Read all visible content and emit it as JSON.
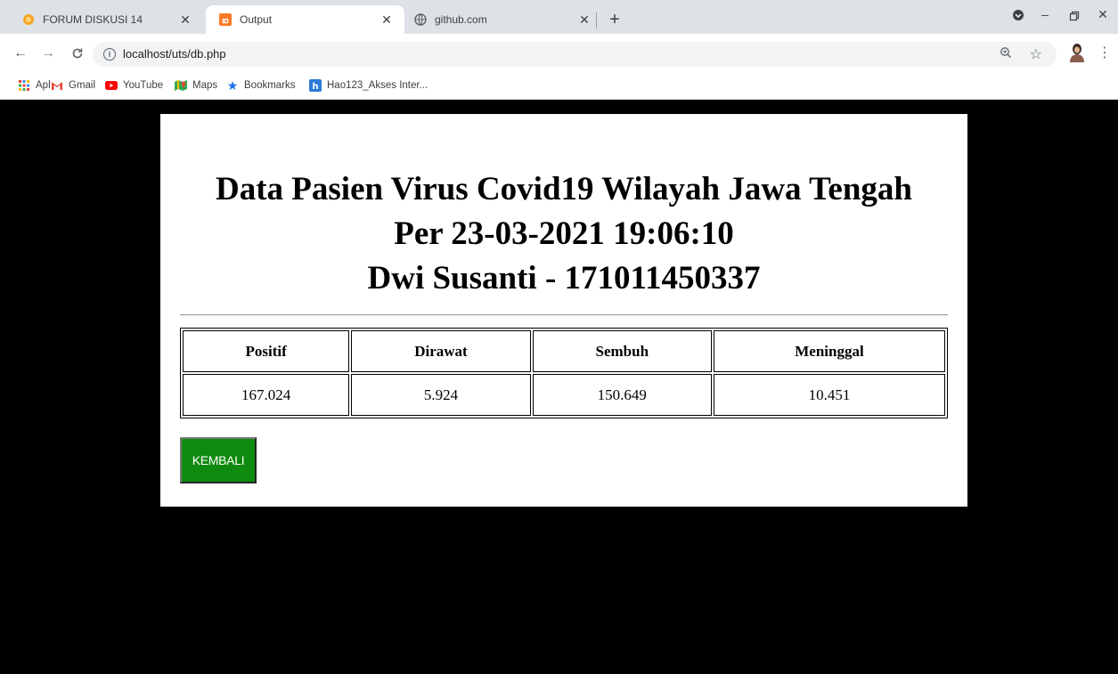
{
  "browser": {
    "tabs": [
      {
        "title": "FORUM DISKUSI 14",
        "icon": "moodle-icon",
        "active": false
      },
      {
        "title": "Output",
        "icon": "xampp-icon",
        "active": true
      },
      {
        "title": "github.com",
        "icon": "globe-icon",
        "active": false
      }
    ],
    "new_tab_glyph": "+",
    "address": {
      "url": "localhost/uts/db.php"
    },
    "bookmarks": [
      {
        "label": "Apl",
        "icon": "apps-grid-icon"
      },
      {
        "label": "Gmail",
        "icon": "gmail-icon"
      },
      {
        "label": "YouTube",
        "icon": "youtube-icon"
      },
      {
        "label": "Maps",
        "icon": "maps-icon"
      },
      {
        "label": "Bookmarks",
        "icon": "star-icon"
      },
      {
        "label": "Hao123_Akses Inter...",
        "icon": "hao123-icon"
      }
    ]
  },
  "page": {
    "heading_line1": "Data Pasien Virus Covid19 Wilayah Jawa Tengah",
    "heading_line2": "Per 23-03-2021 19:06:10",
    "heading_line3": "Dwi Susanti - 171011450337",
    "table": {
      "headers": [
        "Positif",
        "Dirawat",
        "Sembuh",
        "Meninggal"
      ],
      "rows": [
        [
          "167.024",
          "5.924",
          "150.649",
          "10.451"
        ]
      ]
    },
    "back_button": "KEMBALI"
  },
  "colors": {
    "page_background": "#000000",
    "card_background": "#ffffff",
    "button_background": "#0e8a0e",
    "tabstrip": "#dee1e6"
  }
}
